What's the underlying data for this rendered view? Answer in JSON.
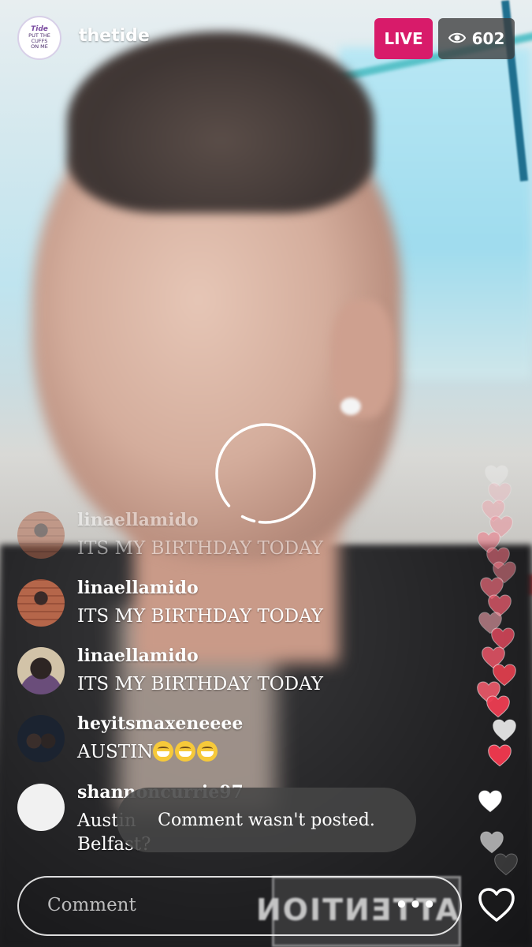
{
  "header": {
    "avatar_text_line1": "Tide",
    "avatar_text_line2": "PUT THE",
    "avatar_text_line3": "CUFFS",
    "avatar_text_line4": "ON ME",
    "username": "thetide",
    "live_label": "LIVE",
    "viewer_count": "602",
    "live_color": "#d81b6a"
  },
  "comments": [
    {
      "user": "linaellamido",
      "text": "ITS MY BIRTHDAY TODAY"
    },
    {
      "user": "linaellamido",
      "text": "ITS MY BIRTHDAY TODAY"
    },
    {
      "user": "linaellamido",
      "text": "ITS MY BIRTHDAY TODAY"
    },
    {
      "user": "heyitsmaxeneeee",
      "text": "AUSTIN"
    },
    {
      "user": "shannoncurrie97",
      "text_line1": "Austin",
      "text_line2": "Belfast?"
    }
  ],
  "toast": {
    "message": "Comment wasn't posted."
  },
  "video_text": "ATTENTION",
  "footer": {
    "comment_placeholder": "Comment",
    "more_label": "•••",
    "like_icon": "heart-outline-icon"
  }
}
